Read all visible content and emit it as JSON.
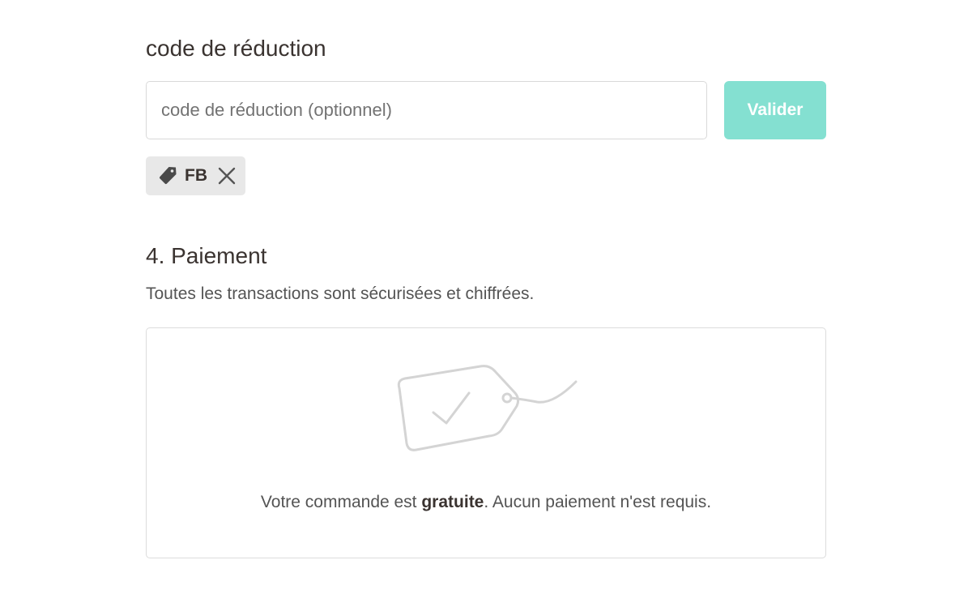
{
  "discount": {
    "title": "code de réduction",
    "input_placeholder": "code de réduction (optionnel)",
    "input_value": "",
    "validate_label": "Valider",
    "applied_code": "FB"
  },
  "payment": {
    "title": "4. Paiement",
    "subtitle": "Toutes les transactions sont sécurisées et chiffrées.",
    "free_message_before": "Votre commande est ",
    "free_message_bold": "gratuite",
    "free_message_after": ". Aucun paiement n'est requis."
  },
  "colors": {
    "accent": "#84e0d1",
    "text": "#3a3330",
    "muted": "#545454",
    "chip_bg": "#e8e8e8"
  },
  "icons": {
    "applied_code": "tag-icon",
    "remove_code": "close-icon",
    "free_order": "price-tag-check-illustration"
  }
}
